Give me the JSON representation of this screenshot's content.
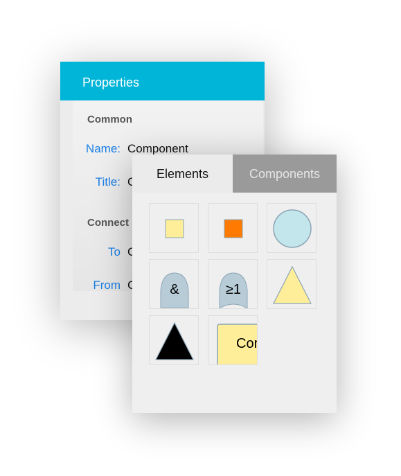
{
  "properties": {
    "title": "Properties",
    "section_common": "Common",
    "name_label": "Name:",
    "name_value": "Component",
    "title_label": "Title:",
    "title_value": "C",
    "section_connect": "Connect",
    "to_label": "To",
    "to_value": "C",
    "from_label": "From",
    "from_value": "C"
  },
  "palette": {
    "tabs": [
      {
        "label": "Elements",
        "active": true
      },
      {
        "label": "Components",
        "active": false
      }
    ],
    "items": [
      {
        "icon": "yellow-square-icon"
      },
      {
        "icon": "orange-square-icon"
      },
      {
        "icon": "circle-icon"
      },
      {
        "icon": "and-gate-icon",
        "text": "&"
      },
      {
        "icon": "or-gate-icon",
        "text": "≥1"
      },
      {
        "icon": "yellow-triangle-icon"
      },
      {
        "icon": "black-triangle-icon"
      },
      {
        "icon": "component-icon",
        "text": "Cor"
      }
    ]
  },
  "colors": {
    "header": "#00b5d8",
    "label": "#1a7fe6",
    "yellow": "#ffee99",
    "orange": "#ff7a00",
    "circle": "#c3e6ec",
    "gate": "#b8ccd8"
  }
}
